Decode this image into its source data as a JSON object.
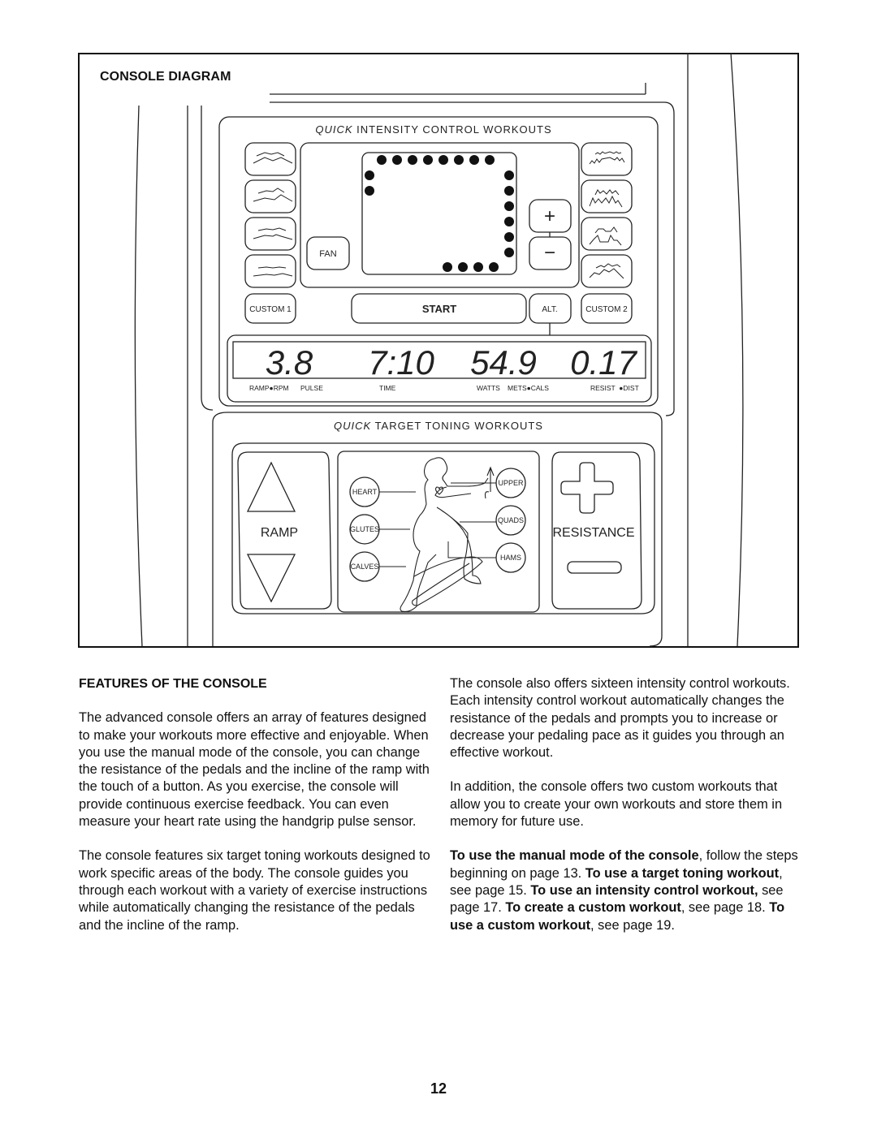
{
  "figure": {
    "title": "CONSOLE DIAGRAM",
    "intensity_panel": {
      "title_italic": "QUICK",
      "title_rest": " INTENSITY CONTROL WORKOUTS",
      "left_profile_buttons": [
        "intensity-workout-1",
        "intensity-workout-2",
        "intensity-workout-3",
        "intensity-workout-4"
      ],
      "right_profile_buttons": [
        "intensity-workout-5",
        "intensity-workout-6",
        "intensity-workout-7",
        "intensity-workout-8"
      ],
      "fan_label": "FAN",
      "plus_label": "+",
      "minus_label": "−",
      "custom1_label": "CUSTOM 1",
      "start_label": "START",
      "alt_label": "ALT.",
      "custom2_label": "CUSTOM 2"
    },
    "display": {
      "values": [
        "3.8",
        "7:10",
        "54.9",
        "0.17"
      ],
      "labels": {
        "ramp_rpm": "RAMP●RPM",
        "pulse": "PULSE",
        "time": "TIME",
        "watts": "WATTS",
        "mets_cals": "METS●CALS",
        "resist_dist": "RESIST  ●DIST"
      }
    },
    "toning_panel": {
      "title_italic": "QUICK",
      "title_rest": " TARGET TONING WORKOUTS",
      "ramp_label": "RAMP",
      "resistance_label": "RESISTANCE",
      "targets": [
        "HEART",
        "GLUTES",
        "CALVES",
        "UPPER",
        "QUADS",
        "HAMS"
      ]
    }
  },
  "left_column": {
    "heading": "FEATURES OF THE CONSOLE",
    "paragraphs": [
      "The advanced console offers an array of features designed to make your workouts more effective and enjoyable. When you use the manual mode of the console, you can change the resistance of the pedals and the incline of the ramp with the touch of a button. As you exercise, the console will provide continuous exercise feedback. You can even measure your heart rate using the handgrip pulse sensor.",
      "The console features six target toning workouts designed to work specific areas of the body. The con­sole guides you through each workout with a variety of exercise instructions while automatically changing the resistance of the pedals and the incline of the ramp."
    ]
  },
  "right_column": {
    "paragraphs": [
      "The console also offers sixteen intensity control work­outs. Each intensity control workout automatically changes the resistance of the pedals and prompts you to increase or decrease your pedaling pace as it guides you through an effective workout.",
      "In addition, the console offers two custom workouts that allow you to create your own workouts and store them in memory for future use."
    ],
    "references": [
      {
        "bold": "To use the manual mode of the console",
        "text": ", follow the steps beginning on page 13. "
      },
      {
        "bold": "To use a target toning workout",
        "text": ", see page 15. "
      },
      {
        "bold": "To use an intensity control workout,",
        "text": " see page 17. "
      },
      {
        "bold": "To create a custom workout",
        "text": ", see page 18. "
      },
      {
        "bold": "To use a custom workout",
        "text": ", see page 19."
      }
    ]
  },
  "page_number": "12"
}
